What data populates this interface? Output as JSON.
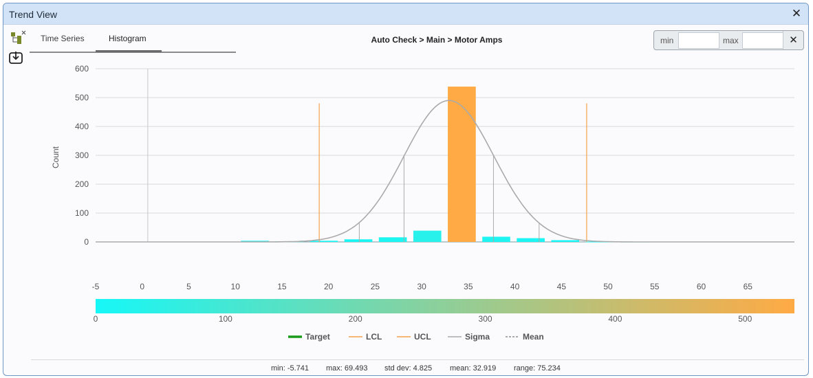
{
  "window": {
    "title": "Trend View"
  },
  "tabs": [
    {
      "label": "Time Series"
    },
    {
      "label": "Histogram"
    }
  ],
  "header": {
    "chart_title": "Auto Check > Main > Motor Amps"
  },
  "range_filter": {
    "min_label": "min",
    "max_label": "max",
    "min_value": "",
    "max_value": "",
    "clear_label": "✕"
  },
  "icons": {
    "close": "close-icon",
    "tree": "tree-view-icon",
    "download": "download-icon"
  },
  "colors": {
    "bar_low": "#16f7f7",
    "bar_high": "#ffaa44",
    "target": "#1a9a1a",
    "lcl": "#f6a24b",
    "ucl": "#f6a24b",
    "sigma": "#aaaaaa",
    "mean": "#777777"
  },
  "chart_data": {
    "type": "bar",
    "ylabel": "Count",
    "ylim": [
      0,
      600
    ],
    "yticks": [
      "0",
      "100",
      "200",
      "300",
      "400",
      "500",
      "600"
    ],
    "xlim": [
      -5,
      70
    ],
    "xticks": [
      "-5",
      "0",
      "5",
      "10",
      "15",
      "20",
      "25",
      "30",
      "35",
      "40",
      "45",
      "50",
      "55",
      "60",
      "65"
    ],
    "bin_width": 3,
    "bars": [
      {
        "x": 12.1,
        "count": 4
      },
      {
        "x": 15.8,
        "count": 2
      },
      {
        "x": 19.5,
        "count": 4
      },
      {
        "x": 23.2,
        "count": 9
      },
      {
        "x": 26.9,
        "count": 16
      },
      {
        "x": 30.6,
        "count": 39
      },
      {
        "x": 34.3,
        "count": 538
      },
      {
        "x": 38.0,
        "count": 18
      },
      {
        "x": 41.7,
        "count": 13
      },
      {
        "x": 45.4,
        "count": 6
      },
      {
        "x": 49.1,
        "count": 1
      },
      {
        "x": 52.8,
        "count": 1
      }
    ],
    "lcl": 19.0,
    "ucl": 47.7,
    "mean": 32.919,
    "std_dev": 4.825,
    "sigma_peak": 490,
    "sigma_lines": [
      23.3,
      28.1,
      37.7,
      42.6
    ],
    "lines_max": 480,
    "y_axis_x": 0.6,
    "colorbar": {
      "min": 0,
      "max": 538,
      "ticks": [
        "0",
        "100",
        "200",
        "300",
        "400",
        "500"
      ]
    },
    "legend": [
      "Target",
      "LCL",
      "UCL",
      "Sigma",
      "Mean"
    ],
    "legend_placement": "bottom"
  },
  "stats": {
    "min": "min: -5.741",
    "max": "max: 69.493",
    "std_dev": "std dev: 4.825",
    "mean": "mean: 32.919",
    "range": "range: 75.234"
  }
}
